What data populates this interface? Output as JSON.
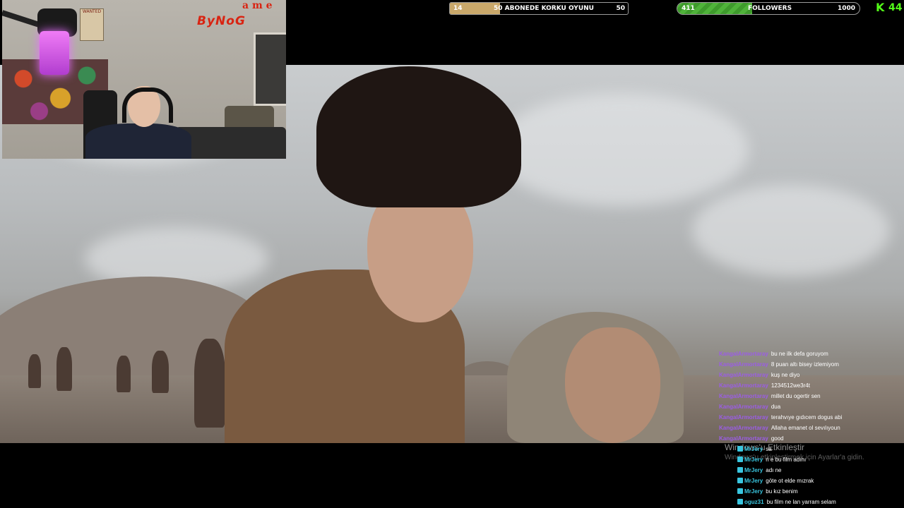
{
  "colors": {
    "subscriber_bar_fill": "#c9a86a",
    "follower_bar_fill": "#4fb33a",
    "kick_green": "#53fc18",
    "chat_user_purple": "#9b5de5",
    "chat_user_teal": "#39c6e0",
    "logo_red": "#d92412"
  },
  "overlay": {
    "subscriber_goal": {
      "current": "14",
      "current_value": 14,
      "goal_value": 50,
      "label": "50 ABONEDE KORKU OYUNU",
      "target": "50"
    },
    "follower_goal": {
      "current": "411",
      "current_value": 411,
      "goal_value": 1000,
      "label": "FOLLOWERS",
      "target": "1000"
    },
    "kick_badge": {
      "icon": "kick-logo-icon",
      "count": "44"
    },
    "streamer_logo": {
      "text": "ByNoG",
      "letters": "a m e"
    }
  },
  "webcam": {
    "poster_text": "WANTED"
  },
  "windows_activation": {
    "title": "Windows'u Etkinleştir",
    "subtitle": "Windows'u etkinleştirmek için Ayarlar'a gidin."
  },
  "chat": [
    {
      "user": "KangalArmortaray",
      "message": "bu ne ilk defa goruyom",
      "style": "purple"
    },
    {
      "user": "KangalArmortaray",
      "message": "8 puan altı bisey izlemiyom",
      "style": "purple"
    },
    {
      "user": "KangalArmortaray",
      "message": "kuş ne diyo",
      "style": "purple"
    },
    {
      "user": "KangalArmortaray",
      "message": "1234512we3r4t",
      "style": "purple"
    },
    {
      "user": "KangalArmortaray",
      "message": "millet du ogertir sen",
      "style": "purple"
    },
    {
      "user": "KangalArmortaray",
      "message": "dua",
      "style": "purple"
    },
    {
      "user": "KangalArmortaray",
      "message": "terahvıye gıdıcem dogus abi",
      "style": "purple"
    },
    {
      "user": "KangalArmortaray",
      "message": "Allaha emanet ol sevılıyoun",
      "style": "purple"
    },
    {
      "user": "KangalArmortaray",
      "message": "good",
      "style": "purple"
    },
    {
      "user": "MrJery",
      "message": "sa",
      "style": "teal"
    },
    {
      "user": "MrJery",
      "message": "n e bu film adını",
      "style": "teal"
    },
    {
      "user": "MrJery",
      "message": "adı ne",
      "style": "teal"
    },
    {
      "user": "MrJery",
      "message": "göte ot elde mızrak",
      "style": "teal"
    },
    {
      "user": "MrJery",
      "message": "bu kız benim",
      "style": "teal"
    },
    {
      "user": "oguz31",
      "message": "bu film ne lan yarram selam",
      "style": "teal"
    }
  ]
}
